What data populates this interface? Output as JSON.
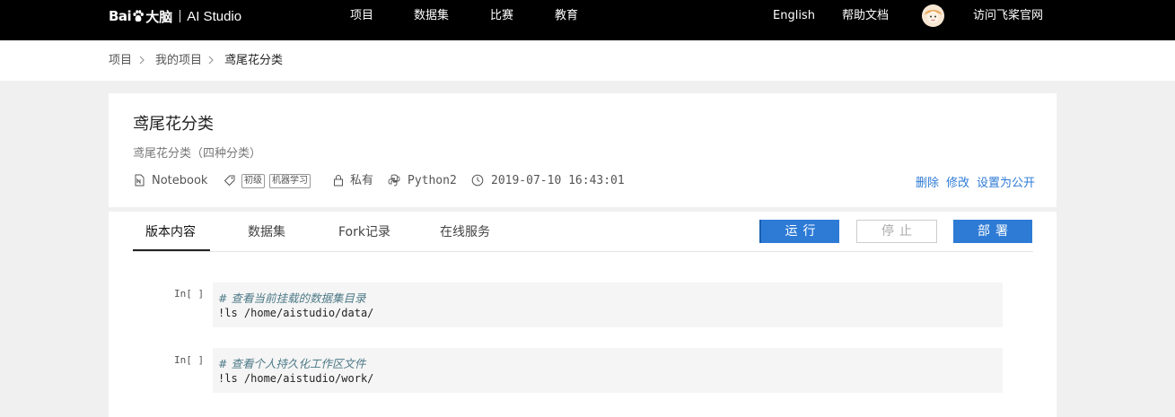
{
  "brand": {
    "bai": "Bai",
    "danao": "大脑",
    "product": "AI Studio"
  },
  "nav": {
    "items": [
      "项目",
      "数据集",
      "比赛",
      "教育"
    ],
    "language": "English",
    "help": "帮助文档",
    "visit": "访问飞桨官网"
  },
  "breadcrumb": [
    "项目",
    "我的项目",
    "鸢尾花分类"
  ],
  "project": {
    "title": "鸢尾花分类",
    "description": "鸢尾花分类（四种分类）",
    "type": "Notebook",
    "tags": [
      "初级",
      "机器学习"
    ],
    "visibility": "私有",
    "env": "Python2",
    "created": "2019-07-10 16:43:01",
    "actions": {
      "delete": "删除",
      "edit": "修改",
      "make_public": "设置为公开"
    }
  },
  "tabs": [
    "版本内容",
    "数据集",
    "Fork记录",
    "在线服务"
  ],
  "buttons": {
    "run": "运行",
    "stop": "停止",
    "deploy": "部署"
  },
  "cells": [
    {
      "prompt": "In[ ]",
      "comment": "# 查看当前挂载的数据集目录",
      "code": "!ls /home/aistudio/data/"
    },
    {
      "prompt": "In[ ]",
      "comment": "# 查看个人持久化工作区文件",
      "code": "!ls /home/aistudio/work/"
    }
  ],
  "colors": {
    "accent": "#2e7bd6",
    "topbar": "#000000"
  }
}
